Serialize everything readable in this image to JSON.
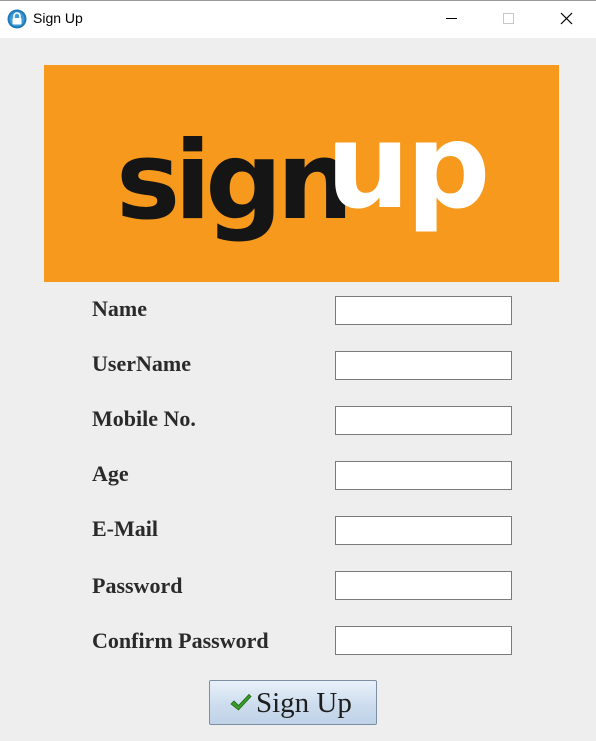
{
  "window": {
    "title": "Sign Up",
    "app_icon": "lock-icon",
    "controls": [
      "minimize-icon",
      "maximize-icon",
      "close-icon"
    ]
  },
  "banner": {
    "logo_text_dark": "sign",
    "logo_text_light": "up",
    "background_color": "#f7991c"
  },
  "form": {
    "fields": [
      {
        "label": "Name",
        "value": ""
      },
      {
        "label": "UserName",
        "value": ""
      },
      {
        "label": "Mobile No.",
        "value": ""
      },
      {
        "label": "Age",
        "value": ""
      },
      {
        "label": "E-Mail",
        "value": ""
      },
      {
        "label": "Password",
        "value": ""
      },
      {
        "label": "Confirm Password",
        "value": ""
      }
    ],
    "submit_label": "Sign Up",
    "submit_icon": "checkmark-icon"
  }
}
